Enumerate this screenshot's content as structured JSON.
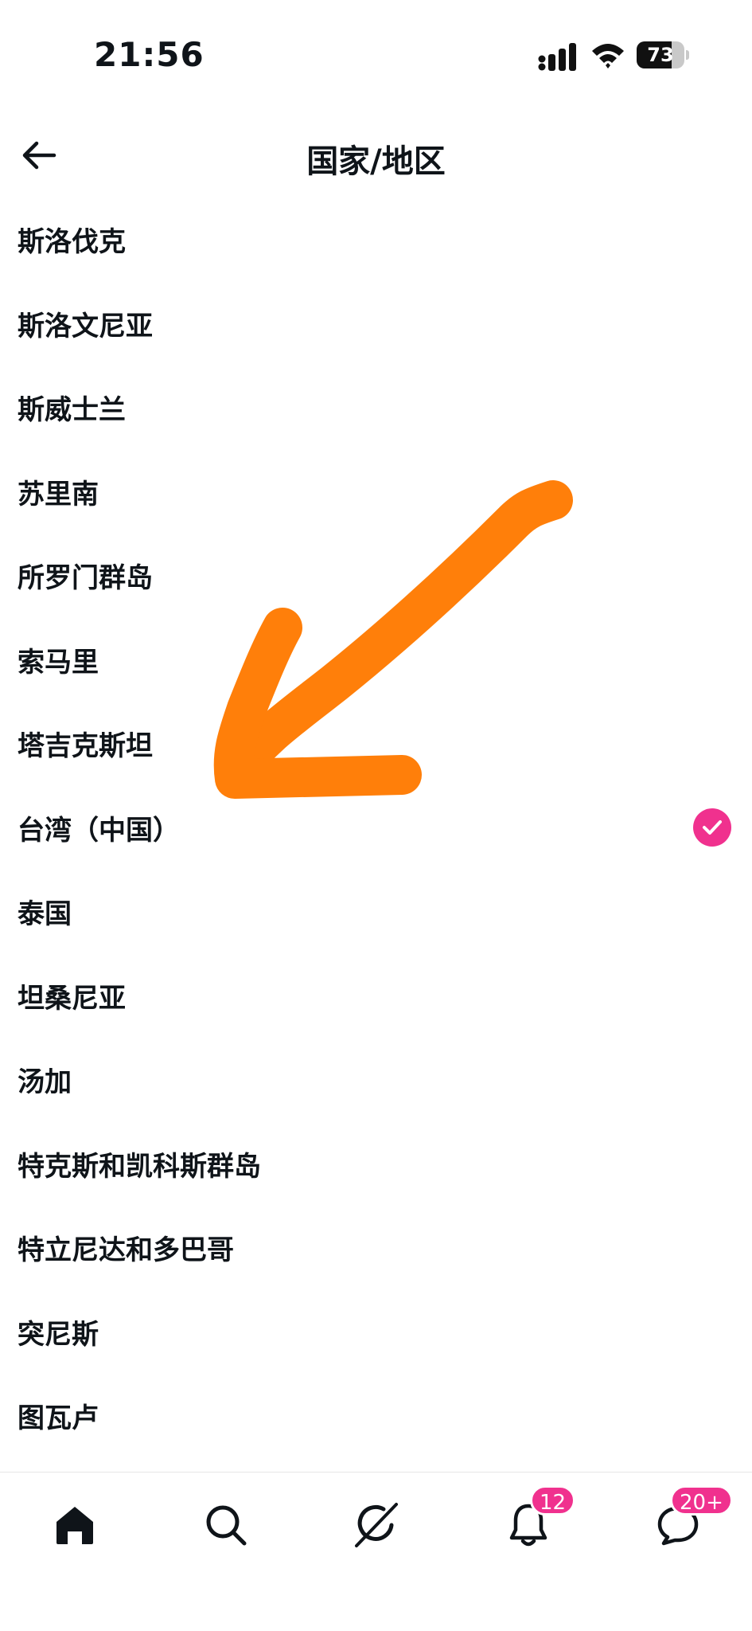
{
  "status_bar": {
    "time": "21:56",
    "battery": "73",
    "battery_level_percent": 73,
    "icons": [
      "signal-icon",
      "wifi-icon",
      "battery-icon"
    ]
  },
  "header": {
    "title": "国家/地区",
    "back_icon": "arrow-left-icon"
  },
  "countries": [
    {
      "label": "斯洛伐克",
      "selected": false
    },
    {
      "label": "斯洛文尼亚",
      "selected": false
    },
    {
      "label": "斯威士兰",
      "selected": false
    },
    {
      "label": "苏里南",
      "selected": false
    },
    {
      "label": "所罗门群岛",
      "selected": false
    },
    {
      "label": "索马里",
      "selected": false
    },
    {
      "label": "塔吉克斯坦",
      "selected": false
    },
    {
      "label": "台湾（中国）",
      "selected": true
    },
    {
      "label": "泰国",
      "selected": false
    },
    {
      "label": "坦桑尼亚",
      "selected": false
    },
    {
      "label": "汤加",
      "selected": false
    },
    {
      "label": "特克斯和凯科斯群岛",
      "selected": false
    },
    {
      "label": "特立尼达和多巴哥",
      "selected": false
    },
    {
      "label": "突尼斯",
      "selected": false
    },
    {
      "label": "图瓦卢",
      "selected": false
    }
  ],
  "bottom_nav": {
    "items": [
      "home-icon",
      "search-icon",
      "grok-icon",
      "notifications-icon",
      "messages-icon"
    ],
    "notifications_badge": "12",
    "messages_badge": "20+"
  },
  "colors": {
    "accent": "#f0318e",
    "annotation": "#ff7f0a",
    "text": "#0f1419"
  }
}
